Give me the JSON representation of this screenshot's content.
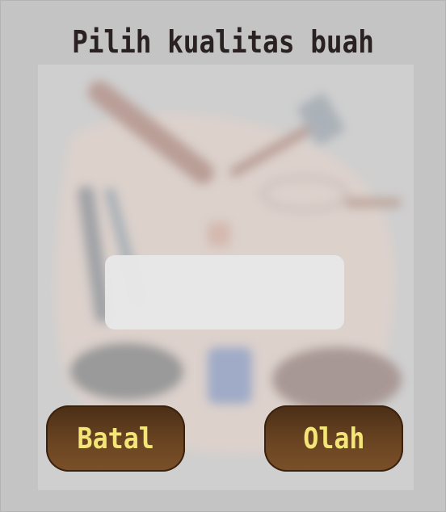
{
  "dialog": {
    "title": "Pilih kualitas buah",
    "result_text": "",
    "cancel_label": "Batal",
    "process_label": "Olah"
  },
  "colors": {
    "background": "#c4c4c4",
    "panel": "#cfcfcf",
    "button_fill": "#6a4422",
    "button_text": "#f3e577",
    "title_text": "#2a2222"
  },
  "icons": {
    "background_image": "kitchen-tools-illustration"
  }
}
